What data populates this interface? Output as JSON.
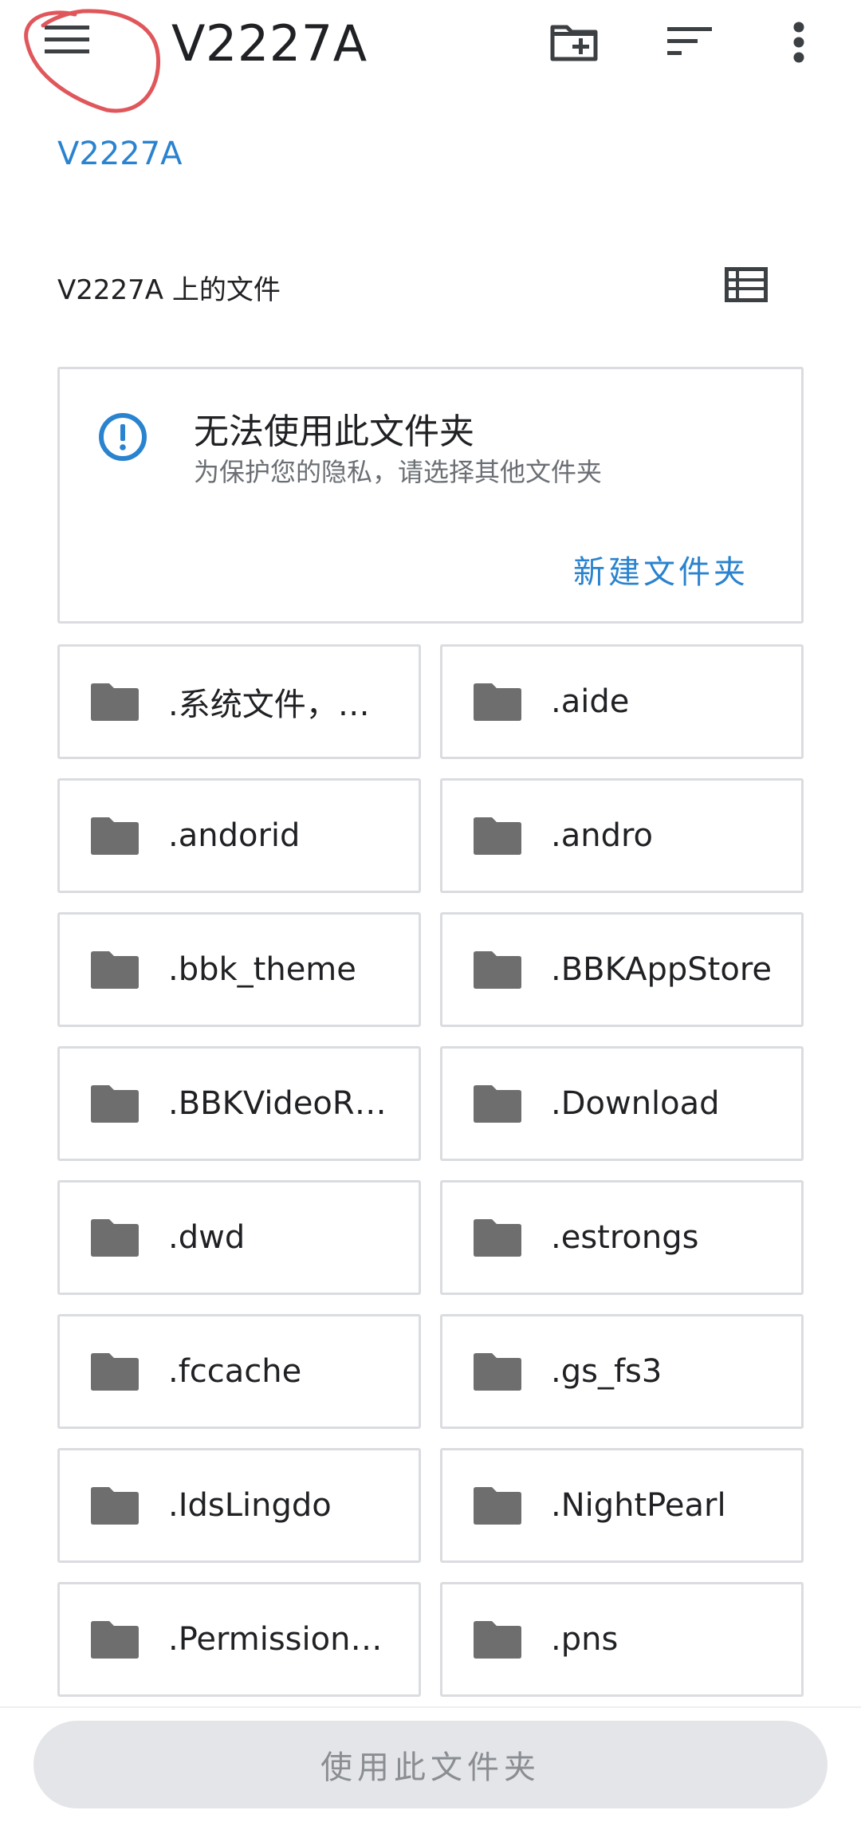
{
  "header": {
    "title": "V2227A",
    "menu_icon": "menu-icon",
    "new_folder_icon": "create-new-folder-icon",
    "sort_icon": "sort-icon",
    "more_icon": "more-vert-icon"
  },
  "breadcrumb": "V2227A",
  "files_heading": "V2227A 上的文件",
  "view_toggle_icon": "list-view-icon",
  "notice": {
    "icon": "info-icon",
    "title": "无法使用此文件夹",
    "subtitle": "为保护您的隐私，请选择其他文件夹",
    "action": "新建文件夹"
  },
  "folders": [
    ".系统文件，…",
    ".aide",
    ".andorid",
    ".andro",
    ".bbk_theme",
    ".BBKAppStore",
    ".BBKVideoR…",
    ".Download",
    ".dwd",
    ".estrongs",
    ".fccache",
    ".gs_fs3",
    ".IdsLingdo",
    ".NightPearl",
    ".Permission…",
    ".pns"
  ],
  "bottom_button": "使用此文件夹",
  "colors": {
    "accent": "#2a83cf",
    "folder_icon": "#6e6e6e",
    "annotation": "#e0575b"
  }
}
